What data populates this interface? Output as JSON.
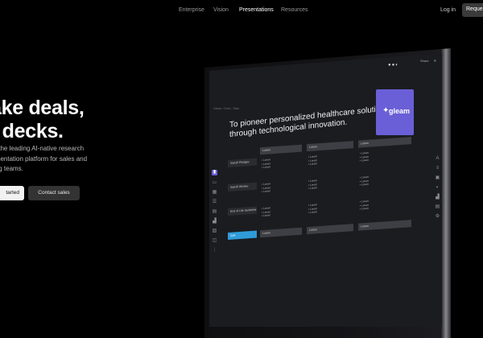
{
  "nav": {
    "links": [
      "Enterprise",
      "Vision",
      "Presentations",
      "Resources"
    ],
    "active": "Presentations",
    "login": "Log in",
    "request": "Request"
  },
  "hero": {
    "title_line1": "ake deals,",
    "title_line2": "t decks.",
    "sub_line1": "s the leading AI-native research",
    "sub_line2": "esentation platform for sales and",
    "sub_line3": "ing teams.",
    "cta_primary": "tarted",
    "cta_secondary": "Contact sales"
  },
  "app": {
    "breadcrumb": "Gleam › Deck › Slide",
    "share": "Share",
    "slide_title_line1": "To pioneer personalized healthcare solutions",
    "slide_title_line2": "through technological innovation.",
    "logo_text": "gleam",
    "columns": [
      "Lorem",
      "Lorem",
      "Lorem"
    ],
    "rows": [
      {
        "label": "Sanofi Pledges",
        "cells": [
          [
            "Lorem",
            "Lorem",
            "Lorem"
          ],
          [
            "Lorem",
            "Lorem",
            "Lorem"
          ],
          [
            "Lorem",
            "Lorem",
            "Lorem"
          ]
        ]
      },
      {
        "label": "Sanofi Wishes",
        "cells": [
          [
            "Lorem",
            "Lorem",
            "Lorem"
          ],
          [
            "Lorem",
            "Lorem",
            "Lorem"
          ],
          [
            "Lorem",
            "Lorem",
            "Lorem"
          ]
        ]
      },
      {
        "label": "End of Life Guideline",
        "cells": [
          [
            "Lorem",
            "Lorem",
            "Lorem"
          ],
          [
            "Lorem",
            "Lorem",
            "Lorem"
          ],
          [
            "Lorem",
            "Lorem",
            "Lorem"
          ]
        ]
      }
    ],
    "add_row_label": "Quit",
    "add_row_cells": [
      "Lorem",
      "Lorem",
      "Lorem"
    ],
    "colors": {
      "accent": "#6a5fd6",
      "add_row": "#2f9bd8",
      "screen_bg": "#1b1c20"
    }
  }
}
